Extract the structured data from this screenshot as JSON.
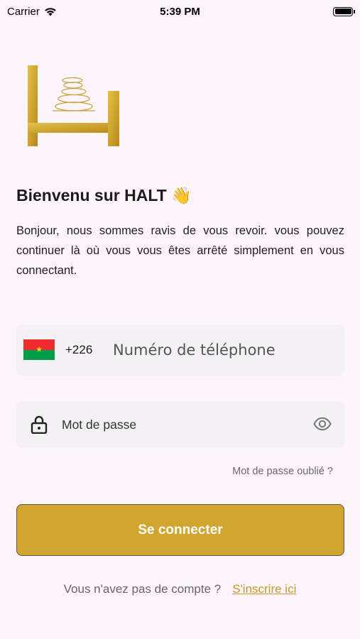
{
  "status_bar": {
    "carrier": "Carrier",
    "time": "5:39 PM",
    "wifi_icon": "wifi-icon",
    "battery_icon": "battery-icon"
  },
  "header": {
    "logo_icon": "halt-bed-stones-logo",
    "title": "Bienvenu sur HALT 👋",
    "subtitle": "Bonjour, nous sommes ravis de vous revoir. vous pouvez continuer là où vous vous êtes arrêté simplement en vous connectant."
  },
  "phone": {
    "flag_icon": "burkina-faso-flag-icon",
    "dial_code": "+226",
    "placeholder": "Numéro de téléphone",
    "value": ""
  },
  "password": {
    "lock_icon": "lock-icon",
    "placeholder": "Mot de passe",
    "value": "",
    "toggle_icon": "eye-icon"
  },
  "forgot_password": "Mot de passe oublié ?",
  "login_button": "Se connecter",
  "signup": {
    "question": "Vous n'avez pas de compte ?",
    "link": "S'inscrire ici"
  },
  "colors": {
    "background": "#fdf5fb",
    "accent_gold": "#d1a62e",
    "field_bg": "#f3f1f4"
  }
}
